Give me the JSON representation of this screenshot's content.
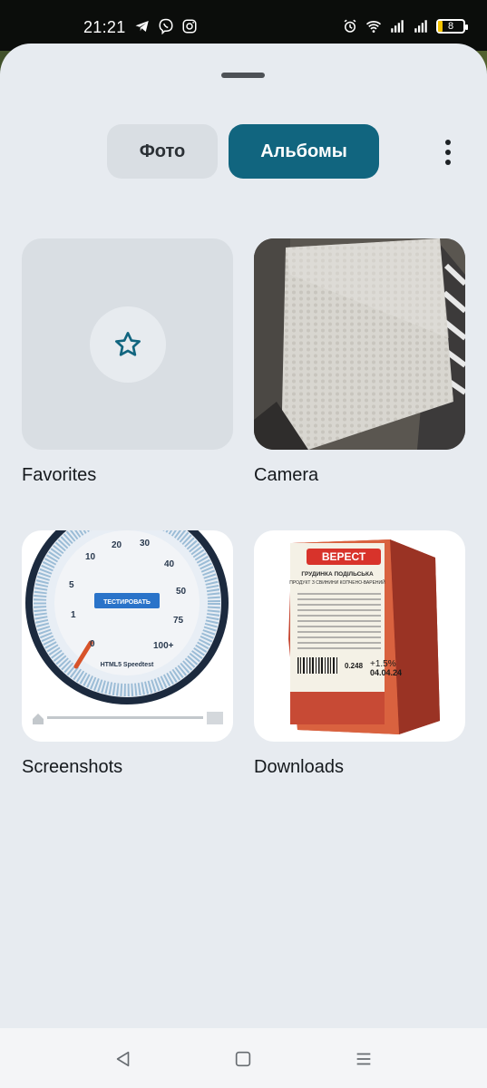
{
  "status_bar": {
    "time": "21:21",
    "battery": "8",
    "icons_left": [
      "telegram-icon",
      "viber-icon",
      "instagram-icon"
    ],
    "icons_right": [
      "alarm-icon",
      "wifi-icon",
      "signal-icon",
      "signal-icon",
      "battery-icon"
    ]
  },
  "tabs": [
    {
      "label": "Фото",
      "active": false
    },
    {
      "label": "Альбомы",
      "active": true
    }
  ],
  "colors": {
    "accent": "#11657f",
    "sheet_bg": "#e7ebf0",
    "tab_inactive_bg": "#d9dee3"
  },
  "albums": [
    {
      "name": "Favorites",
      "icon": "star-icon"
    },
    {
      "name": "Camera",
      "icon": ""
    },
    {
      "name": "Screenshots",
      "icon": "",
      "thumb": {
        "gauge_ticks": [
          "0",
          "1",
          "5",
          "10",
          "20",
          "30",
          "40",
          "50",
          "75",
          "100+"
        ],
        "button_label": "ТЕСТИРОВАТЬ",
        "caption": "HTML5 Speedtest"
      }
    },
    {
      "name": "Downloads",
      "icon": "",
      "thumb": {
        "brand": "ВЕРЕСТ",
        "product": "ГРУДИНКА ПОДІЛЬСЬКА",
        "subtitle": "ПРОДУКТ З СВИНИНИ КОПЧЕНО-ВАРЕНИЙ",
        "weight": "0.248",
        "tolerance": "+1.5%",
        "date": "04.04.24"
      }
    }
  ],
  "navbar": {
    "buttons": [
      "back-icon",
      "home-icon",
      "menu-icon"
    ]
  }
}
